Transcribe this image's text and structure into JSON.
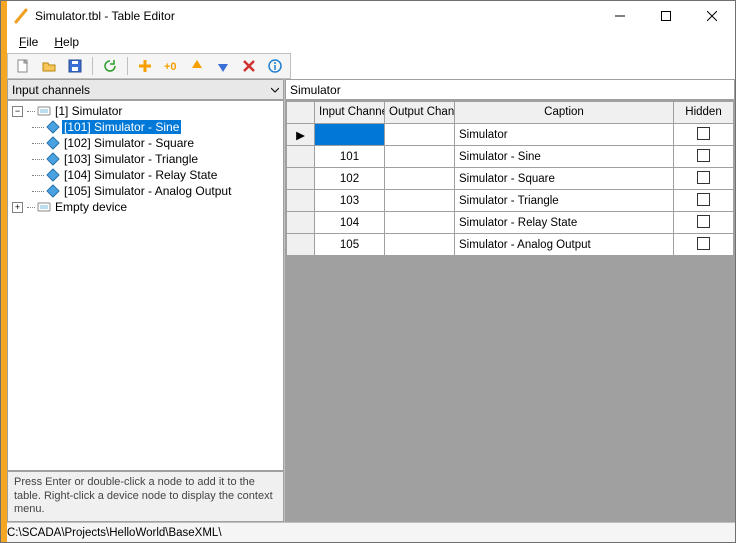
{
  "window": {
    "title": "Simulator.tbl - Table Editor"
  },
  "menu": {
    "file": "File",
    "help": "Help"
  },
  "left": {
    "header": "Input channels",
    "hint": "Press Enter or double-click a node to add it to the table. Right-click a device node to display the context menu.",
    "tree": {
      "device1": "[1] Simulator",
      "n101": "[101] Simulator - Sine",
      "n102": "[102] Simulator - Square",
      "n103": "[103] Simulator - Triangle",
      "n104": "[104] Simulator - Relay State",
      "n105": "[105] Simulator - Analog Output",
      "empty": "Empty device"
    }
  },
  "right": {
    "filter": "Simulator",
    "headers": {
      "input": "Input Channel",
      "output": "Output Channel",
      "caption": "Caption",
      "hidden": "Hidden"
    },
    "rows": [
      {
        "in": "",
        "out": "",
        "cap": "Simulator"
      },
      {
        "in": "101",
        "out": "",
        "cap": "Simulator - Sine"
      },
      {
        "in": "102",
        "out": "",
        "cap": "Simulator - Square"
      },
      {
        "in": "103",
        "out": "",
        "cap": "Simulator - Triangle"
      },
      {
        "in": "104",
        "out": "",
        "cap": "Simulator - Relay State"
      },
      {
        "in": "105",
        "out": "",
        "cap": "Simulator - Analog Output"
      }
    ]
  },
  "status": {
    "path": "C:\\SCADA\\Projects\\HelloWorld\\BaseXML\\"
  },
  "glyph": {
    "minus": "−",
    "plus": "+",
    "tri": "▶"
  }
}
